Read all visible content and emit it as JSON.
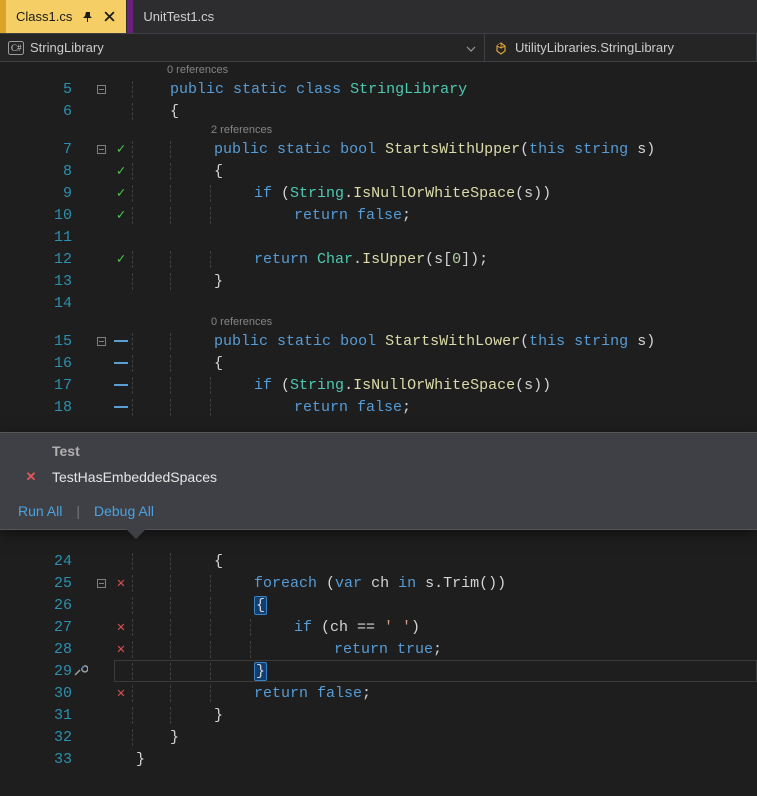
{
  "tabs": {
    "active": "Class1.cs",
    "inactive": "UnitTest1.cs"
  },
  "navbar": {
    "left": "StringLibrary",
    "right": "UtilityLibraries.StringLibrary"
  },
  "codelens": {
    "ref0a": "0 references",
    "ref2": "2 references",
    "ref0b": "0 references"
  },
  "code": {
    "l5": {
      "t1": "public",
      "t2": "static",
      "t3": "class",
      "t4": "StringLibrary"
    },
    "l6": {
      "b": "{"
    },
    "l7": {
      "t1": "public",
      "t2": "static",
      "t3": "bool",
      "t4": "StartsWithUpper",
      "p": "(",
      "t5": "this",
      "t6": "string",
      "t7": "s",
      "e": ")"
    },
    "l8": {
      "b": "{"
    },
    "l9": {
      "t1": "if",
      "p": "(",
      "t2": "String",
      "dot": ".",
      "t3": "IsNullOrWhiteSpace",
      "p2": "(s))"
    },
    "l10": {
      "t1": "return",
      "t2": "false",
      "sc": ";"
    },
    "l12": {
      "t1": "return",
      "t2": "Char",
      "dot": ".",
      "t3": "IsUpper",
      "rest": "(s[",
      "n": "0",
      "rest2": "]);"
    },
    "l13": {
      "b": "}"
    },
    "l15": {
      "t1": "public",
      "t2": "static",
      "t3": "bool",
      "t4": "StartsWithLower",
      "p": "(",
      "t5": "this",
      "t6": "string",
      "t7": "s",
      "e": ")"
    },
    "l16": {
      "b": "{"
    },
    "l17": {
      "t1": "if",
      "p": "(",
      "t2": "String",
      "dot": ".",
      "t3": "IsNullOrWhiteSpace",
      "p2": "(s))"
    },
    "l18": {
      "t1": "return",
      "t2": "false",
      "sc": ";"
    },
    "l24": {
      "b": "{"
    },
    "l25": {
      "t1": "foreach",
      "p": "(",
      "t2": "var",
      "t3": "ch",
      "t4": "in",
      "rest": " s.Trim())"
    },
    "l26": {
      "b": "{"
    },
    "l27": {
      "t1": "if",
      "rest": " (ch == ",
      "s": "' '",
      "e": ")"
    },
    "l28": {
      "t1": "return",
      "t2": "true",
      "sc": ";"
    },
    "l29": {
      "b": "}"
    },
    "l30": {
      "t1": "return",
      "t2": "false",
      "sc": ";"
    },
    "l31": {
      "b": "}"
    },
    "l32": {
      "b": "}"
    },
    "l33": {
      "b": "}"
    }
  },
  "lineNumbers": {
    "n5": "5",
    "n6": "6",
    "n7": "7",
    "n8": "8",
    "n9": "9",
    "n10": "10",
    "n11": "11",
    "n12": "12",
    "n13": "13",
    "n14": "14",
    "n15": "15",
    "n16": "16",
    "n17": "17",
    "n18": "18",
    "n24": "24",
    "n25": "25",
    "n26": "26",
    "n27": "27",
    "n28": "28",
    "n29": "29",
    "n30": "30",
    "n31": "31",
    "n32": "32",
    "n33": "33"
  },
  "testPopup": {
    "header": "Test",
    "name": "TestHasEmbeddedSpaces",
    "runAll": "Run All",
    "debugAll": "Debug All"
  }
}
